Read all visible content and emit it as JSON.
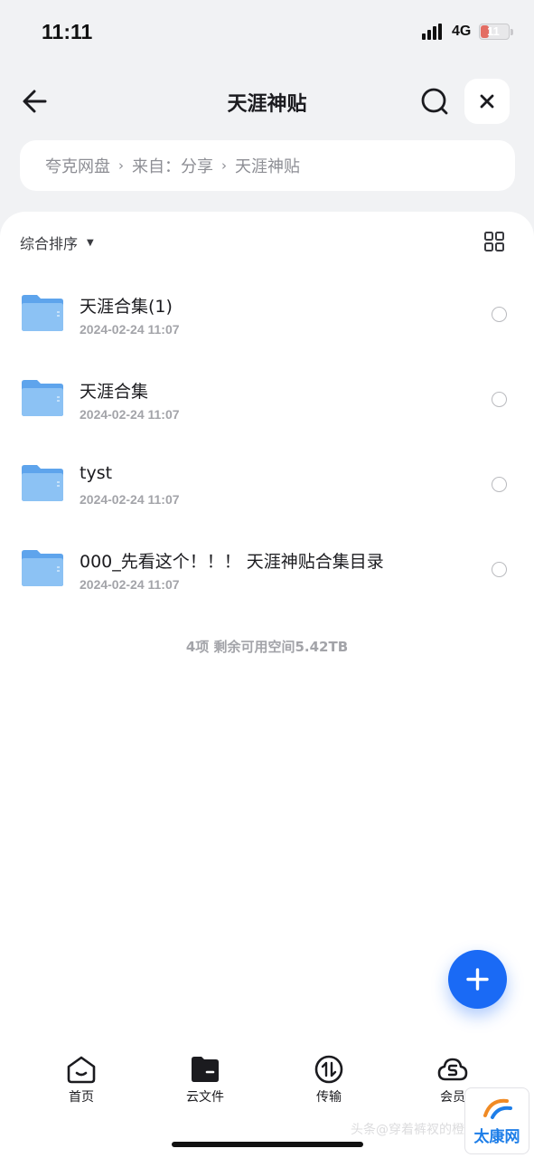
{
  "status_bar": {
    "time": "11:11",
    "network": "4G",
    "battery": "11",
    "battery_level": 0.11
  },
  "nav": {
    "title": "天涯神贴"
  },
  "breadcrumb": {
    "items": [
      "夸克网盘",
      "来自：分享",
      "天涯神贴"
    ],
    "separator": "›"
  },
  "toolbar": {
    "sort_label": "综合排序"
  },
  "files": [
    {
      "name": "天涯合集(1)",
      "date": "2024-02-24 11:07"
    },
    {
      "name": "天涯合集",
      "date": "2024-02-24 11:07"
    },
    {
      "name": "tyst",
      "date": "2024-02-24 11:07"
    },
    {
      "name": "000_先看这个！！！ 天涯神贴合集目录",
      "date": "2024-02-24 11:07"
    }
  ],
  "summary": "4项 剩余可用空间5.42TB",
  "tabs": [
    {
      "label": "首页",
      "icon": "home-icon"
    },
    {
      "label": "云文件",
      "icon": "folder-icon"
    },
    {
      "label": "传输",
      "icon": "transfer-icon"
    },
    {
      "label": "会员",
      "icon": "vip-icon"
    }
  ],
  "watermark": {
    "text": "头条@穿着裤衩的橙子",
    "logo": "太康网"
  },
  "colors": {
    "accent": "#1a6af5",
    "folder": "#7fb8f0",
    "background": "#f1f2f4"
  }
}
